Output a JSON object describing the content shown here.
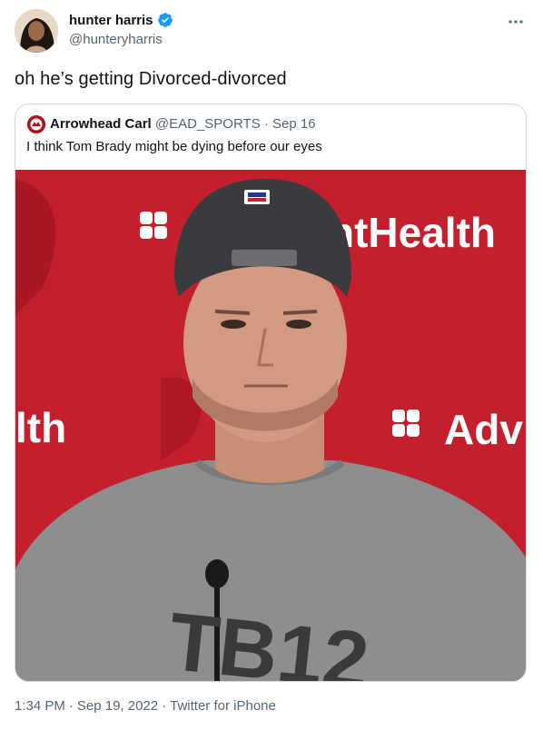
{
  "author": {
    "display_name": "hunter harris",
    "handle": "@hunteryharris"
  },
  "tweet": {
    "text": "oh he’s getting Divorced-divorced"
  },
  "quoted": {
    "display_name": "Arrowhead Carl",
    "handle": "@EAD_SPORTS",
    "separator": "·",
    "date": "Sep 16",
    "text": "I think Tom Brady might be dying before our eyes",
    "image": {
      "backdrop_text_1": "ntHealth",
      "backdrop_text_2": "lth",
      "backdrop_text_3": "Adv",
      "shirt_text": "TB12",
      "colors": {
        "backdrop": "#c8202f",
        "shirt": "#8e8e8e",
        "cap": "#3a3b3e"
      }
    }
  },
  "meta": {
    "time": "1:34 PM",
    "separator1": "·",
    "date": "Sep 19, 2022",
    "separator2": "·",
    "source": "Twitter for iPhone"
  },
  "icons": {
    "verified": "verified-badge-icon",
    "more": "more-options-icon"
  },
  "colors": {
    "verified_blue": "#1d9bf0",
    "secondary_text": "#536471",
    "border": "#cfd9de"
  }
}
